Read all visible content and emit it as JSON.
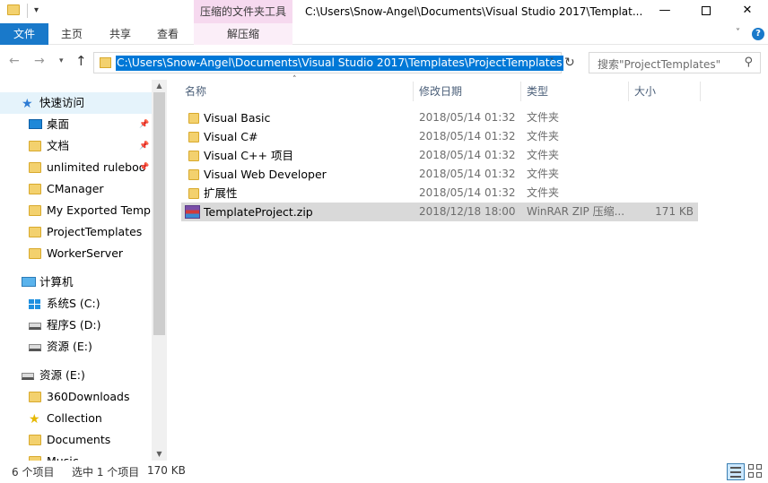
{
  "window": {
    "title": "C:\\Users\\Snow-Angel\\Documents\\Visual Studio 2017\\Templat...",
    "context_tab": "压缩的文件夹工具",
    "buttons": {
      "minimize": "—",
      "close": "✕"
    }
  },
  "ribbon": {
    "file": "文件",
    "home": "主页",
    "share": "共享",
    "view": "查看",
    "extract": "解压缩"
  },
  "address": {
    "path": "C:\\Users\\Snow-Angel\\Documents\\Visual Studio 2017\\Templates\\ProjectTemplates",
    "search_placeholder": "搜索\"ProjectTemplates\""
  },
  "navpane": {
    "items": [
      {
        "label": "快速访问",
        "icon": "star-icon",
        "indent": 1,
        "selected": true
      },
      {
        "label": "桌面",
        "icon": "desktop-icon",
        "indent": 2,
        "pinned": true
      },
      {
        "label": "文档",
        "icon": "folder-icon",
        "indent": 2,
        "pinned": true
      },
      {
        "label": "unlimited ruleboo",
        "icon": "folder-icon",
        "indent": 2,
        "pinned": true
      },
      {
        "label": "CManager",
        "icon": "folder-icon",
        "indent": 2
      },
      {
        "label": "My Exported Templ",
        "icon": "folder-icon",
        "indent": 2
      },
      {
        "label": "ProjectTemplates",
        "icon": "folder-icon",
        "indent": 2
      },
      {
        "label": "WorkerServer",
        "icon": "folder-icon",
        "indent": 2
      },
      {
        "label": "计算机",
        "icon": "computer-icon",
        "indent": 1,
        "gap": true
      },
      {
        "label": "系统S (C:)",
        "icon": "windows-drive-icon",
        "indent": 2
      },
      {
        "label": "程序S (D:)",
        "icon": "drive-icon",
        "indent": 2
      },
      {
        "label": "资源 (E:)",
        "icon": "drive-icon",
        "indent": 2
      },
      {
        "label": "资源 (E:)",
        "icon": "drive-icon",
        "indent": 1,
        "gap": true
      },
      {
        "label": "360Downloads",
        "icon": "folder-icon",
        "indent": 2
      },
      {
        "label": "Collection",
        "icon": "star-yellow-icon",
        "indent": 2
      },
      {
        "label": "Documents",
        "icon": "folder-icon",
        "indent": 2
      },
      {
        "label": "Music",
        "icon": "folder-icon",
        "indent": 2
      }
    ]
  },
  "columns": {
    "name": "名称",
    "date": "修改日期",
    "type": "类型",
    "size": "大小"
  },
  "files": [
    {
      "name": "Visual Basic",
      "date": "2018/05/14 01:32",
      "type": "文件夹",
      "size": "",
      "icon": "folder-icon"
    },
    {
      "name": "Visual C#",
      "date": "2018/05/14 01:32",
      "type": "文件夹",
      "size": "",
      "icon": "folder-icon"
    },
    {
      "name": "Visual C++ 项目",
      "date": "2018/05/14 01:32",
      "type": "文件夹",
      "size": "",
      "icon": "folder-icon"
    },
    {
      "name": "Visual Web Developer",
      "date": "2018/05/14 01:32",
      "type": "文件夹",
      "size": "",
      "icon": "folder-icon"
    },
    {
      "name": "扩展性",
      "date": "2018/05/14 01:32",
      "type": "文件夹",
      "size": "",
      "icon": "folder-icon"
    },
    {
      "name": "TemplateProject.zip",
      "date": "2018/12/18 18:00",
      "type": "WinRAR ZIP 压缩...",
      "size": "171 KB",
      "icon": "zip-archive-icon",
      "selected": true
    }
  ],
  "status": {
    "count": "6 个项目",
    "selected": "选中 1 个项目",
    "size": "170 KB"
  },
  "colors": {
    "accent": "#1979ca",
    "context_tab": "#f6d9ef",
    "nav_selected": "#e5f3fb",
    "row_selected": "#d9d9d9",
    "path_highlight": "#0078d7"
  }
}
